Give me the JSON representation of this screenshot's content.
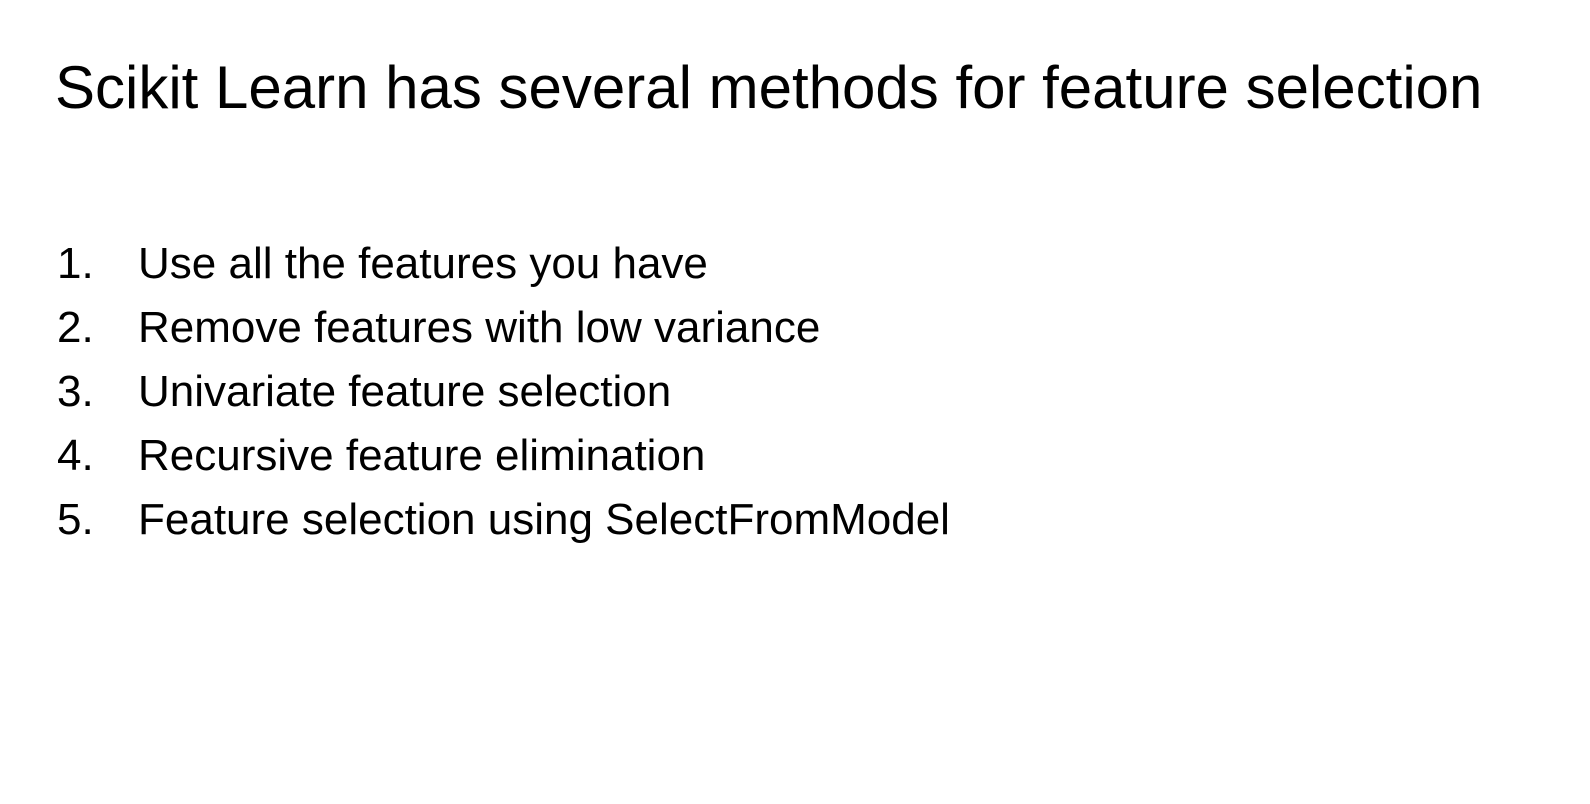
{
  "slide": {
    "title": "Scikit Learn has several methods for feature selection",
    "methods": [
      {
        "number": "1.",
        "text": "Use all the features you have"
      },
      {
        "number": "2.",
        "text": "Remove features with low variance"
      },
      {
        "number": "3.",
        "text": "Univariate feature selection"
      },
      {
        "number": "4.",
        "text": "Recursive feature elimination"
      },
      {
        "number": "5.",
        "text": "Feature selection using SelectFromModel"
      }
    ]
  },
  "colors": {
    "background": "#ffffff",
    "text": "#000000"
  }
}
